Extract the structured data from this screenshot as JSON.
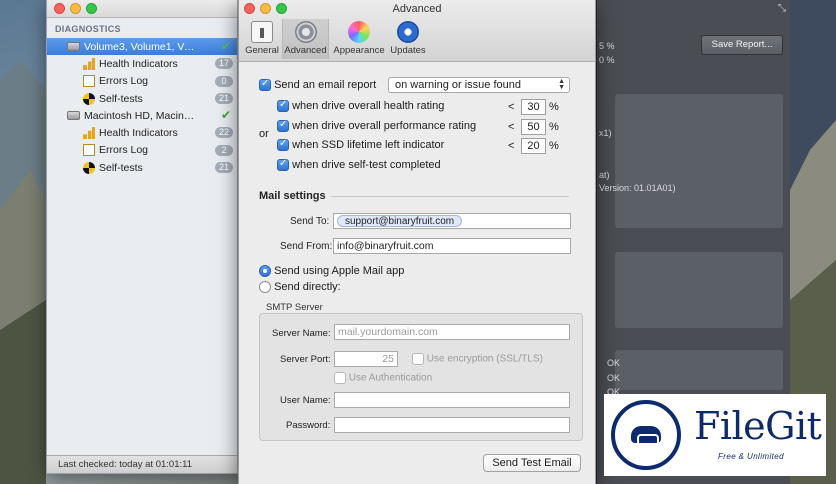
{
  "sidebar": {
    "heading": "DIAGNOSTICS",
    "drives": [
      {
        "name": "Volume3, Volume1, Vo...",
        "status_icon": "check-icon",
        "children": [
          {
            "label": "Health Indicators",
            "badge": "17"
          },
          {
            "label": "Errors Log",
            "badge": "0"
          },
          {
            "label": "Self-tests",
            "badge": "21"
          }
        ]
      },
      {
        "name": "Macintosh HD, Macintos...",
        "status_icon": "check-icon",
        "children": [
          {
            "label": "Health Indicators",
            "badge": "22"
          },
          {
            "label": "Errors Log",
            "badge": "2"
          },
          {
            "label": "Self-tests",
            "badge": "21"
          }
        ]
      }
    ],
    "status": "Last checked: today at 01:01:11"
  },
  "background_window": {
    "save_button": "Save Report...",
    "fragments": [
      "5 %",
      "0 %",
      "x1)",
      "at)",
      "Version: 01.01A01)",
      "OK",
      "OK",
      "OK",
      "OK"
    ]
  },
  "dialog": {
    "title": "Advanced",
    "toolbar": [
      {
        "label": "General",
        "icon": "general-icon"
      },
      {
        "label": "Advanced",
        "icon": "gear-icon"
      },
      {
        "label": "Appearance",
        "icon": "color-wheel-icon"
      },
      {
        "label": "Updates",
        "icon": "updates-icon"
      }
    ],
    "email": {
      "checkbox_label": "Send an email report",
      "trigger": "on warning or issue found",
      "or_label": "or",
      "conditions": [
        {
          "label": "when drive overall health rating",
          "op": "<",
          "value": "30",
          "unit": "%"
        },
        {
          "label": "when drive overall performance rating",
          "op": "<",
          "value": "50",
          "unit": "%"
        },
        {
          "label": "when SSD lifetime left indicator",
          "op": "<",
          "value": "20",
          "unit": "%"
        },
        {
          "label": "when drive self-test completed"
        }
      ]
    },
    "mail": {
      "section_title": "Mail settings",
      "send_to_label": "Send To:",
      "send_to_token": "support@binaryfruit.com",
      "send_from_label": "Send From:",
      "send_from_value": "info@binaryfruit.com",
      "radio_apple": "Send using Apple Mail app",
      "radio_direct": "Send directly:"
    },
    "smtp": {
      "title": "SMTP Server",
      "server_label": "Server Name:",
      "server_placeholder": "mail.yourdomain.com",
      "port_label": "Server Port:",
      "port_placeholder": "25",
      "encryption_label": "Use encryption (SSL/TLS)",
      "auth_label": "Use Authentication",
      "user_label": "User Name:",
      "password_label": "Password:"
    },
    "test_button": "Send Test Email"
  },
  "watermark": {
    "title": "FileGit",
    "subtitle": "Free & Unlimited"
  }
}
